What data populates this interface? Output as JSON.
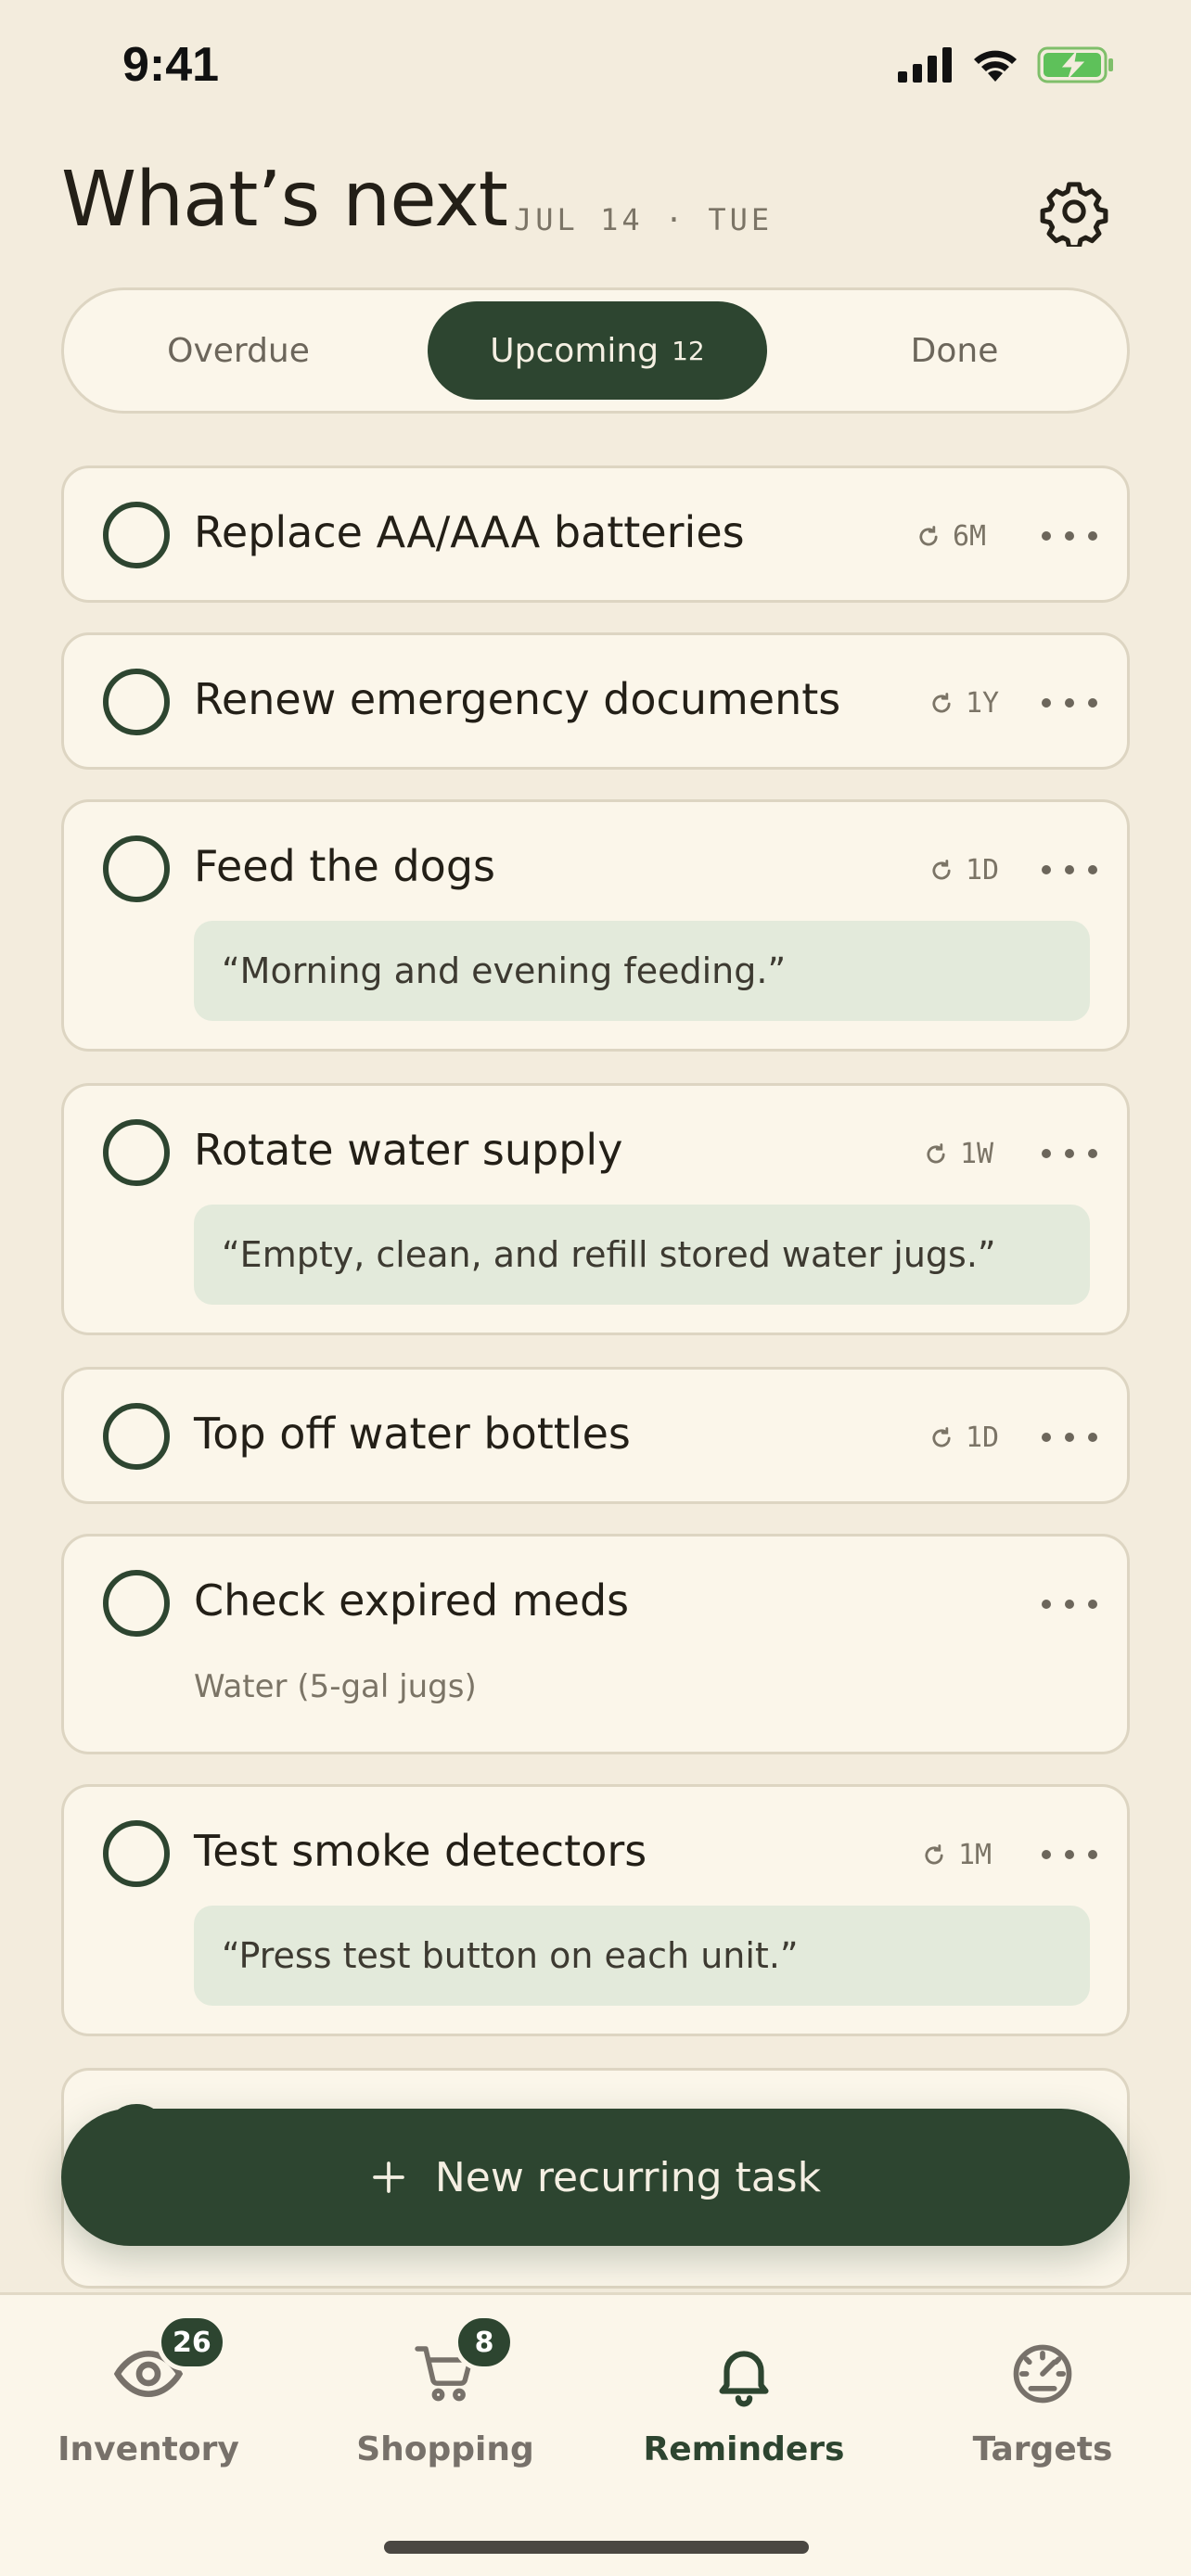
{
  "status_bar": {
    "time": "9:41"
  },
  "header": {
    "title": "What’s next",
    "date": "JUL 14 · TUE"
  },
  "tabs": [
    {
      "label": "Overdue",
      "count": ""
    },
    {
      "label": "Upcoming",
      "count": "12"
    },
    {
      "label": "Done",
      "count": ""
    }
  ],
  "tasks": [
    {
      "title": "Replace AA/AAA batteries",
      "recurrence": "6M"
    },
    {
      "title": "Renew emergency documents",
      "recurrence": "1Y"
    },
    {
      "title": "Feed the dogs",
      "recurrence": "1D",
      "note": "“Morning and evening feeding.”"
    },
    {
      "title": "Rotate water supply",
      "recurrence": "1W",
      "note": "“Empty, clean, and refill stored water jugs.”"
    },
    {
      "title": "Top off water bottles",
      "recurrence": "1D"
    },
    {
      "title": "Check expired meds",
      "subtitle": "Water (5-gal jugs)"
    },
    {
      "title": "Test smoke detectors",
      "recurrence": "1M",
      "note": "“Press test button on each unit.”"
    }
  ],
  "fab": {
    "label": "New recurring task"
  },
  "tabbar": [
    {
      "label": "Inventory",
      "badge": "26"
    },
    {
      "label": "Shopping",
      "badge": "8"
    },
    {
      "label": "Reminders",
      "badge": ""
    },
    {
      "label": "Targets",
      "badge": ""
    }
  ],
  "colors": {
    "accent": "#2d4530",
    "background": "#f3ecdd",
    "card": "#fbf6ea",
    "note": "#e3eadb"
  }
}
